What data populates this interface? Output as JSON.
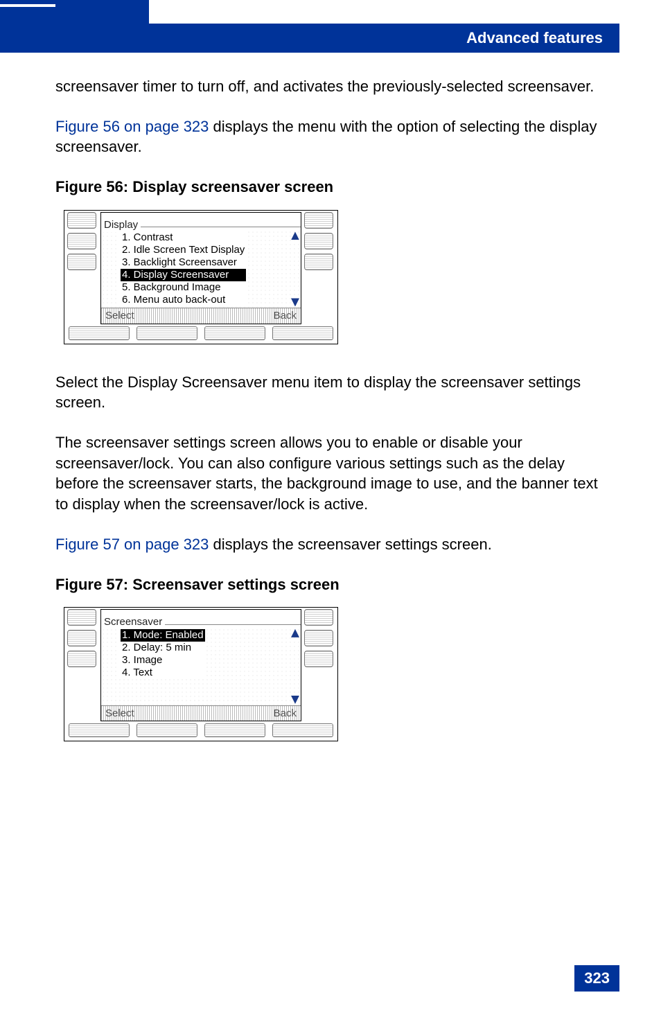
{
  "header": {
    "title": "Advanced features"
  },
  "page_number": "323",
  "intro_1": "screensaver timer to turn off, and activates the previously-selected screensaver.",
  "fig56_link": "Figure 56 on page 323",
  "fig56_sentence_rest": " displays the menu with the option of selecting the display screensaver.",
  "fig56_title": "Figure 56: Display screensaver screen",
  "phone1": {
    "screen_title": "Display",
    "items": [
      "1. Contrast",
      "2. Idle Screen Text Display",
      "3. Backlight Screensaver",
      "4. Display Screensaver",
      "5. Background Image",
      "6. Menu auto back-out"
    ],
    "selected_index": 3,
    "softkey_left": "Select",
    "softkey_right": "Back"
  },
  "mid_para_1": "Select the Display Screensaver menu item to display the screensaver settings screen.",
  "mid_para_2": "The screensaver settings screen allows you to enable or disable your screensaver/lock. You can also configure various settings such as the delay before the screensaver starts, the background image to use, and the banner text to display when the screensaver/lock is active.",
  "fig57_link": "Figure 57 on page 323",
  "fig57_sentence_rest": " displays the screensaver settings screen.",
  "fig57_title": "Figure 57: Screensaver settings screen",
  "phone2": {
    "screen_title": "Screensaver",
    "items": [
      "1. Mode:  Enabled",
      "2. Delay: 5 min",
      "3. Image",
      "4. Text"
    ],
    "selected_index": 0,
    "softkey_left": "Select",
    "softkey_right": "Back"
  }
}
